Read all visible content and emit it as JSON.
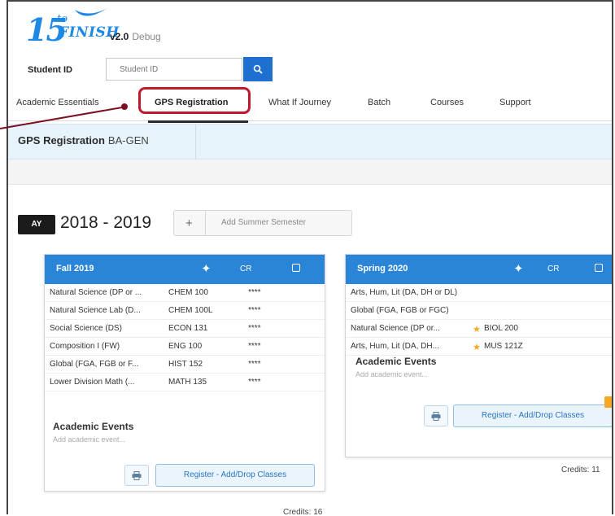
{
  "header": {
    "logo_15": "15",
    "logo_to": "to",
    "logo_finish": "FINISH",
    "version": "v2.0",
    "debug": "Debug"
  },
  "student_id": {
    "label": "Student ID",
    "placeholder": "Student ID"
  },
  "tabs": [
    {
      "label": "Academic Essentials"
    },
    {
      "label": "GPS Registration",
      "active": true
    },
    {
      "label": "What If Journey"
    },
    {
      "label": "Batch"
    },
    {
      "label": "Courses"
    },
    {
      "label": "Support"
    }
  ],
  "page": {
    "title": "GPS Registration",
    "code": "BA-GEN"
  },
  "academic_year": {
    "badge": "AY",
    "years": "2018 - 2019",
    "add_summer": "Add Summer Semester",
    "plus": "+"
  },
  "semesters": [
    {
      "title": "Fall 2019",
      "cr_label": "CR",
      "courses": [
        {
          "requirement": "Natural Science (DP or ...",
          "course": "CHEM 100",
          "credits": "****"
        },
        {
          "requirement": "Natural Science Lab (D...",
          "course": "CHEM 100L",
          "credits": "****"
        },
        {
          "requirement": "Social Science (DS)",
          "course": "ECON 131",
          "credits": "****"
        },
        {
          "requirement": "Composition I (FW)",
          "course": "ENG 100",
          "credits": "****"
        },
        {
          "requirement": "Global (FGA, FGB or F...",
          "course": "HIST 152",
          "credits": "****"
        },
        {
          "requirement": "Lower Division Math (...",
          "course": "MATH 135",
          "credits": "****"
        }
      ],
      "events_title": "Academic Events",
      "events_placeholder": "Add academic event...",
      "register_label": "Register - Add/Drop Classes",
      "credits_text": "Credits: 16"
    },
    {
      "title": "Spring 2020",
      "cr_label": "CR",
      "courses": [
        {
          "requirement": "Arts, Hum, Lit (DA, DH or DL)",
          "course": "",
          "credits": ""
        },
        {
          "requirement": "Global (FGA, FGB or FGC)",
          "course": "",
          "credits": ""
        },
        {
          "requirement": "Natural Science (DP or...",
          "course": "BIOL 200",
          "credits": "",
          "starred": true
        },
        {
          "requirement": "Arts, Hum, Lit (DA, DH...",
          "course": "MUS 121Z",
          "credits": "",
          "starred": true
        }
      ],
      "events_title": "Academic Events",
      "events_placeholder": "Add academic event...",
      "register_label": "Register - Add/Drop Classes",
      "credits_text": "Credits: 11"
    }
  ],
  "colors": {
    "brand_blue": "#1e88e5",
    "card_header": "#2a85d8",
    "highlight_red": "#c0182f",
    "title_band": "#e7f3fb"
  },
  "icons": [
    "search-icon",
    "plus-icon",
    "print-icon",
    "note-icon",
    "star-icon",
    "logo-swoosh-icon"
  ]
}
